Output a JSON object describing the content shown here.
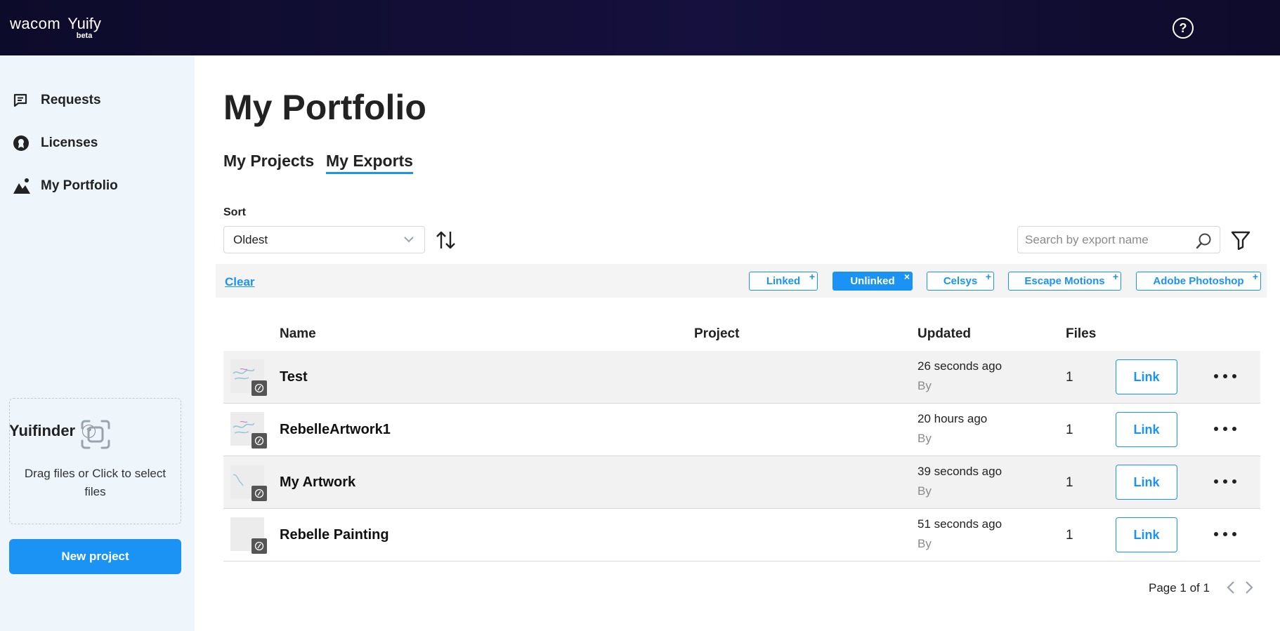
{
  "header": {
    "brand": "wacom",
    "product": "Yuify",
    "badge": "beta",
    "help_glyph": "?"
  },
  "sidebar": {
    "items": [
      {
        "label": "Requests",
        "icon": "requests-icon"
      },
      {
        "label": "Licenses",
        "icon": "license-icon"
      },
      {
        "label": "My Portfolio",
        "icon": "portfolio-icon"
      }
    ],
    "yuifinder": {
      "title": "Yuifinder",
      "help_glyph": "?",
      "drop_text": "Drag files or Click to select files"
    },
    "new_project_label": "New project"
  },
  "main": {
    "title": "My Portfolio",
    "tabs": [
      {
        "label": "My Projects",
        "active": false
      },
      {
        "label": "My Exports",
        "active": true
      }
    ],
    "sort": {
      "label": "Sort",
      "selected": "Oldest"
    },
    "search": {
      "placeholder": "Search by export name"
    },
    "filters": {
      "clear_label": "Clear",
      "chips": [
        {
          "label": "Linked",
          "mark": "+",
          "active": false
        },
        {
          "label": "Unlinked",
          "mark": "×",
          "active": true
        },
        {
          "label": "Celsys",
          "mark": "+",
          "active": false
        },
        {
          "label": "Escape Motions",
          "mark": "+",
          "active": false
        },
        {
          "label": "Adobe Photoshop",
          "mark": "+",
          "active": false
        }
      ]
    },
    "table": {
      "columns": [
        "Name",
        "Project",
        "Updated",
        "Files"
      ],
      "rows": [
        {
          "name": "Test",
          "project": "",
          "updated": "26 seconds ago",
          "by": "By",
          "files": "1",
          "action": "Link"
        },
        {
          "name": "RebelleArtwork1",
          "project": "",
          "updated": "20 hours ago",
          "by": "By",
          "files": "1",
          "action": "Link"
        },
        {
          "name": "My Artwork",
          "project": "",
          "updated": "39 seconds ago",
          "by": "By",
          "files": "1",
          "action": "Link"
        },
        {
          "name": "Rebelle Painting",
          "project": "",
          "updated": "51 seconds ago",
          "by": "By",
          "files": "1",
          "action": "Link"
        }
      ]
    },
    "pagination": {
      "text": "Page 1 of 1"
    }
  },
  "colors": {
    "accent": "#1a93f5",
    "header_bg": "#0d0b2a",
    "sidebar_bg": "#eef6fc"
  }
}
